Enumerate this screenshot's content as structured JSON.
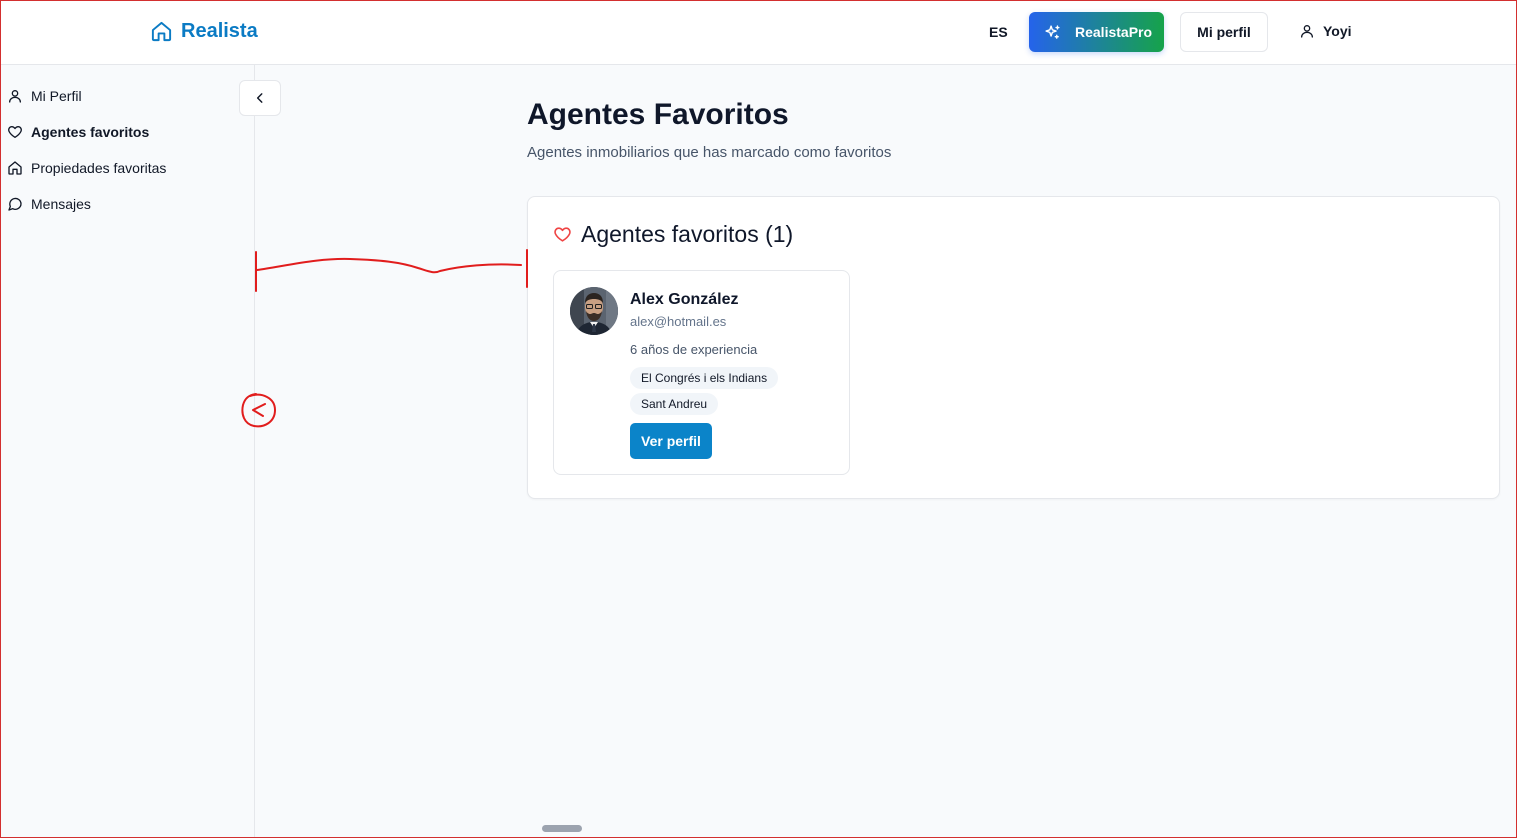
{
  "header": {
    "brand": "Realista",
    "language": "ES",
    "pro_label": "RealistaPro",
    "profile_label": "Mi perfil",
    "user_name": "Yoyi"
  },
  "sidebar": {
    "items": [
      {
        "label": "Mi Perfil",
        "icon": "user-icon"
      },
      {
        "label": "Agentes favoritos",
        "icon": "heart-icon",
        "active": true
      },
      {
        "label": "Propiedades favoritas",
        "icon": "home-icon"
      },
      {
        "label": "Mensajes",
        "icon": "message-circle-icon"
      }
    ]
  },
  "main": {
    "title": "Agentes Favoritos",
    "subtitle": "Agentes inmobiliarios que has marcado como favoritos",
    "panel_title": "Agentes favoritos (1)",
    "agents": [
      {
        "name": "Alex González",
        "email": "alex@hotmail.es",
        "experience": "6 años de experiencia",
        "areas": [
          "El Congrés i els Indians",
          "Sant Andreu"
        ],
        "button": "Ver perfil"
      }
    ]
  },
  "colors": {
    "brand": "#0b7bc4",
    "primary_button": "#0b84c9",
    "pro_gradient_start": "#2563eb",
    "pro_gradient_end": "#16a34a",
    "heart": "#ef4444",
    "annotation": "#e11d1d"
  }
}
